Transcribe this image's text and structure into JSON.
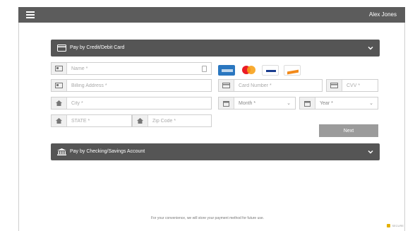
{
  "header": {
    "user_name": "Alex Jones"
  },
  "card_panel": {
    "title": "Pay by Credit/Debit Card"
  },
  "form": {
    "name_placeholder": "Name *",
    "billing_address_placeholder": "Billing Address *",
    "city_placeholder": "City *",
    "state_placeholder": "STATE *",
    "zip_placeholder": "Zip Code *",
    "card_number_placeholder": "Card Number *",
    "cvv_placeholder": "CVV *",
    "month_value": "Month *",
    "year_value": "Year *"
  },
  "card_brands": [
    "amex",
    "mastercard",
    "visa",
    "discover"
  ],
  "actions": {
    "next_label": "Next"
  },
  "bank_panel": {
    "title": "Pay by Checking/Savings Account"
  },
  "footer": {
    "note": "For your convenience, we will store your payment method for future use.",
    "secure_label": "SECURE"
  },
  "colors": {
    "topbar": "#5c5c5c",
    "panel": "#555555",
    "button": "#9b9b9b"
  }
}
